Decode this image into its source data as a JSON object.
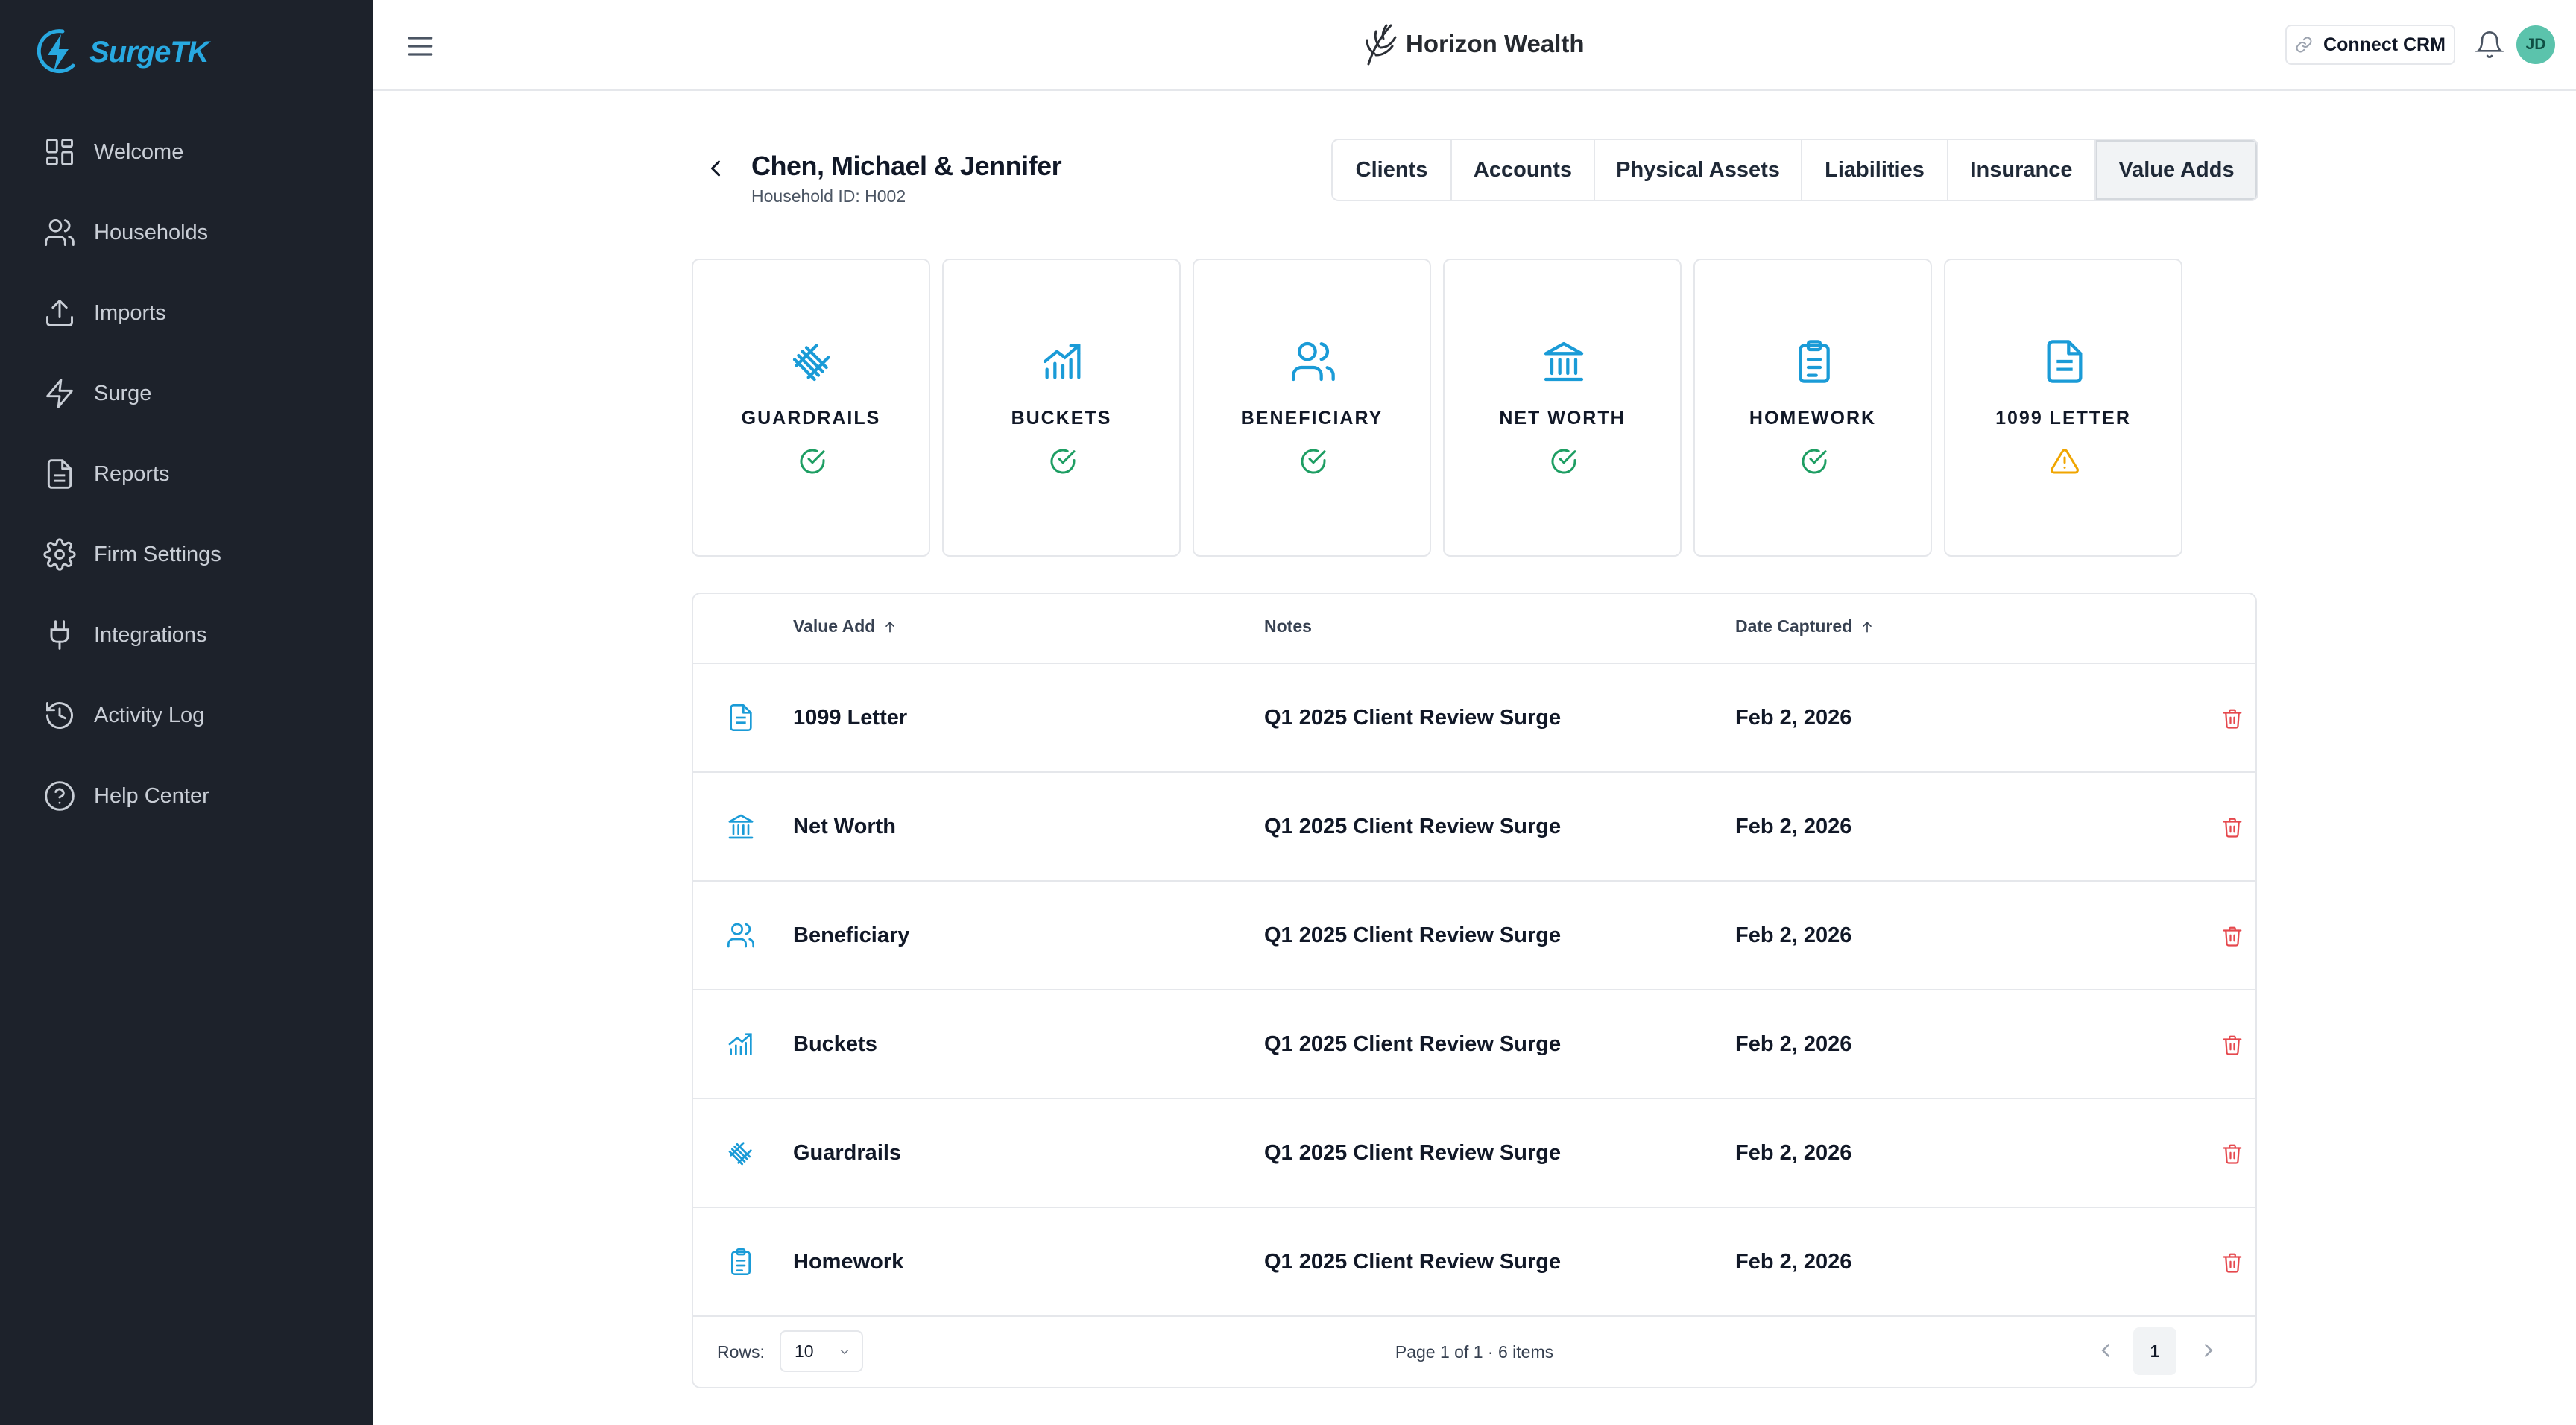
{
  "brand": {
    "name": "SurgeTK",
    "logo_icon": "lightning-bolt-circle-icon",
    "accent": "#28a9e1"
  },
  "sidebar": {
    "items": [
      {
        "label": "Welcome",
        "icon": "dashboard-grid-icon"
      },
      {
        "label": "Households",
        "icon": "users-icon"
      },
      {
        "label": "Imports",
        "icon": "upload-icon"
      },
      {
        "label": "Surge",
        "icon": "lightning-icon"
      },
      {
        "label": "Reports",
        "icon": "document-icon"
      },
      {
        "label": "Firm Settings",
        "icon": "gear-icon"
      },
      {
        "label": "Integrations",
        "icon": "plug-icon"
      },
      {
        "label": "Activity Log",
        "icon": "history-icon"
      },
      {
        "label": "Help Center",
        "icon": "help-circle-icon"
      }
    ]
  },
  "header": {
    "firm_name": "Horizon Wealth",
    "connect_crm_label": "Connect CRM",
    "avatar_initials": "JD",
    "avatar_color": "#5bc3ac"
  },
  "household": {
    "name": "Chen, Michael & Jennifer",
    "id_text": "Household ID: H002"
  },
  "tabs": [
    {
      "label": "Clients",
      "active": false
    },
    {
      "label": "Accounts",
      "active": false
    },
    {
      "label": "Physical Assets",
      "active": false
    },
    {
      "label": "Liabilities",
      "active": false
    },
    {
      "label": "Insurance",
      "active": false
    },
    {
      "label": "Value Adds",
      "active": true
    }
  ],
  "cards": [
    {
      "label": "GUARDRAILS",
      "icon": "railroad-track-icon",
      "status": "complete"
    },
    {
      "label": "BUCKETS",
      "icon": "bar-chart-trend-icon",
      "status": "complete"
    },
    {
      "label": "BENEFICIARY",
      "icon": "users-icon",
      "status": "complete"
    },
    {
      "label": "NET WORTH",
      "icon": "bank-icon",
      "status": "complete"
    },
    {
      "label": "HOMEWORK",
      "icon": "clipboard-list-icon",
      "status": "complete"
    },
    {
      "label": "1099 LETTER",
      "icon": "document-text-icon",
      "status": "warning"
    }
  ],
  "status_colors": {
    "complete": "#1e9e63",
    "warning": "#f0a500",
    "icon": "#1a9bd7",
    "delete": "#e5484d"
  },
  "table": {
    "columns": {
      "value_add": "Value Add",
      "notes": "Notes",
      "date_captured": "Date Captured"
    },
    "rows": [
      {
        "name": "1099 Letter",
        "icon": "document-text-icon",
        "notes": "Q1 2025 Client Review Surge",
        "date": "Feb 2, 2026"
      },
      {
        "name": "Net Worth",
        "icon": "bank-icon",
        "notes": "Q1 2025 Client Review Surge",
        "date": "Feb 2, 2026"
      },
      {
        "name": "Beneficiary",
        "icon": "users-icon",
        "notes": "Q1 2025 Client Review Surge",
        "date": "Feb 2, 2026"
      },
      {
        "name": "Buckets",
        "icon": "bar-chart-trend-icon",
        "notes": "Q1 2025 Client Review Surge",
        "date": "Feb 2, 2026"
      },
      {
        "name": "Guardrails",
        "icon": "railroad-track-icon",
        "notes": "Q1 2025 Client Review Surge",
        "date": "Feb 2, 2026"
      },
      {
        "name": "Homework",
        "icon": "clipboard-list-icon",
        "notes": "Q1 2025 Client Review Surge",
        "date": "Feb 2, 2026"
      }
    ],
    "footer": {
      "rows_label": "Rows:",
      "rows_value": "10",
      "page_info": "Page 1 of 1 · 6 items",
      "current_page": "1"
    }
  }
}
